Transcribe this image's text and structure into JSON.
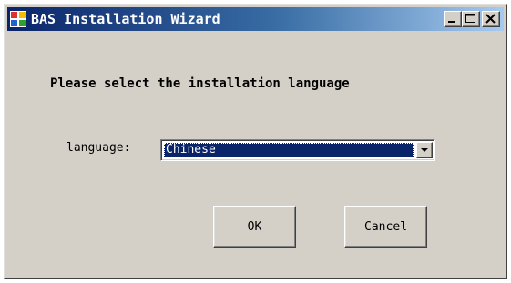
{
  "window": {
    "title": "BAS Installation Wizard",
    "icon": "app-window-icon"
  },
  "titlebar_buttons": {
    "minimize_icon": "minimize-icon",
    "maximize_icon": "maximize-icon",
    "close_icon": "close-icon"
  },
  "dialog": {
    "heading": "Please select the installation language",
    "language_label": "language:",
    "language_select": {
      "selected": "Chinese",
      "arrow_icon": "chevron-down-icon"
    },
    "ok_label": "OK",
    "cancel_label": "Cancel"
  },
  "colors": {
    "titlebar_start": "#0a246a",
    "titlebar_end": "#a6caf0",
    "face": "#d4d0c8",
    "selection": "#0a246a"
  }
}
